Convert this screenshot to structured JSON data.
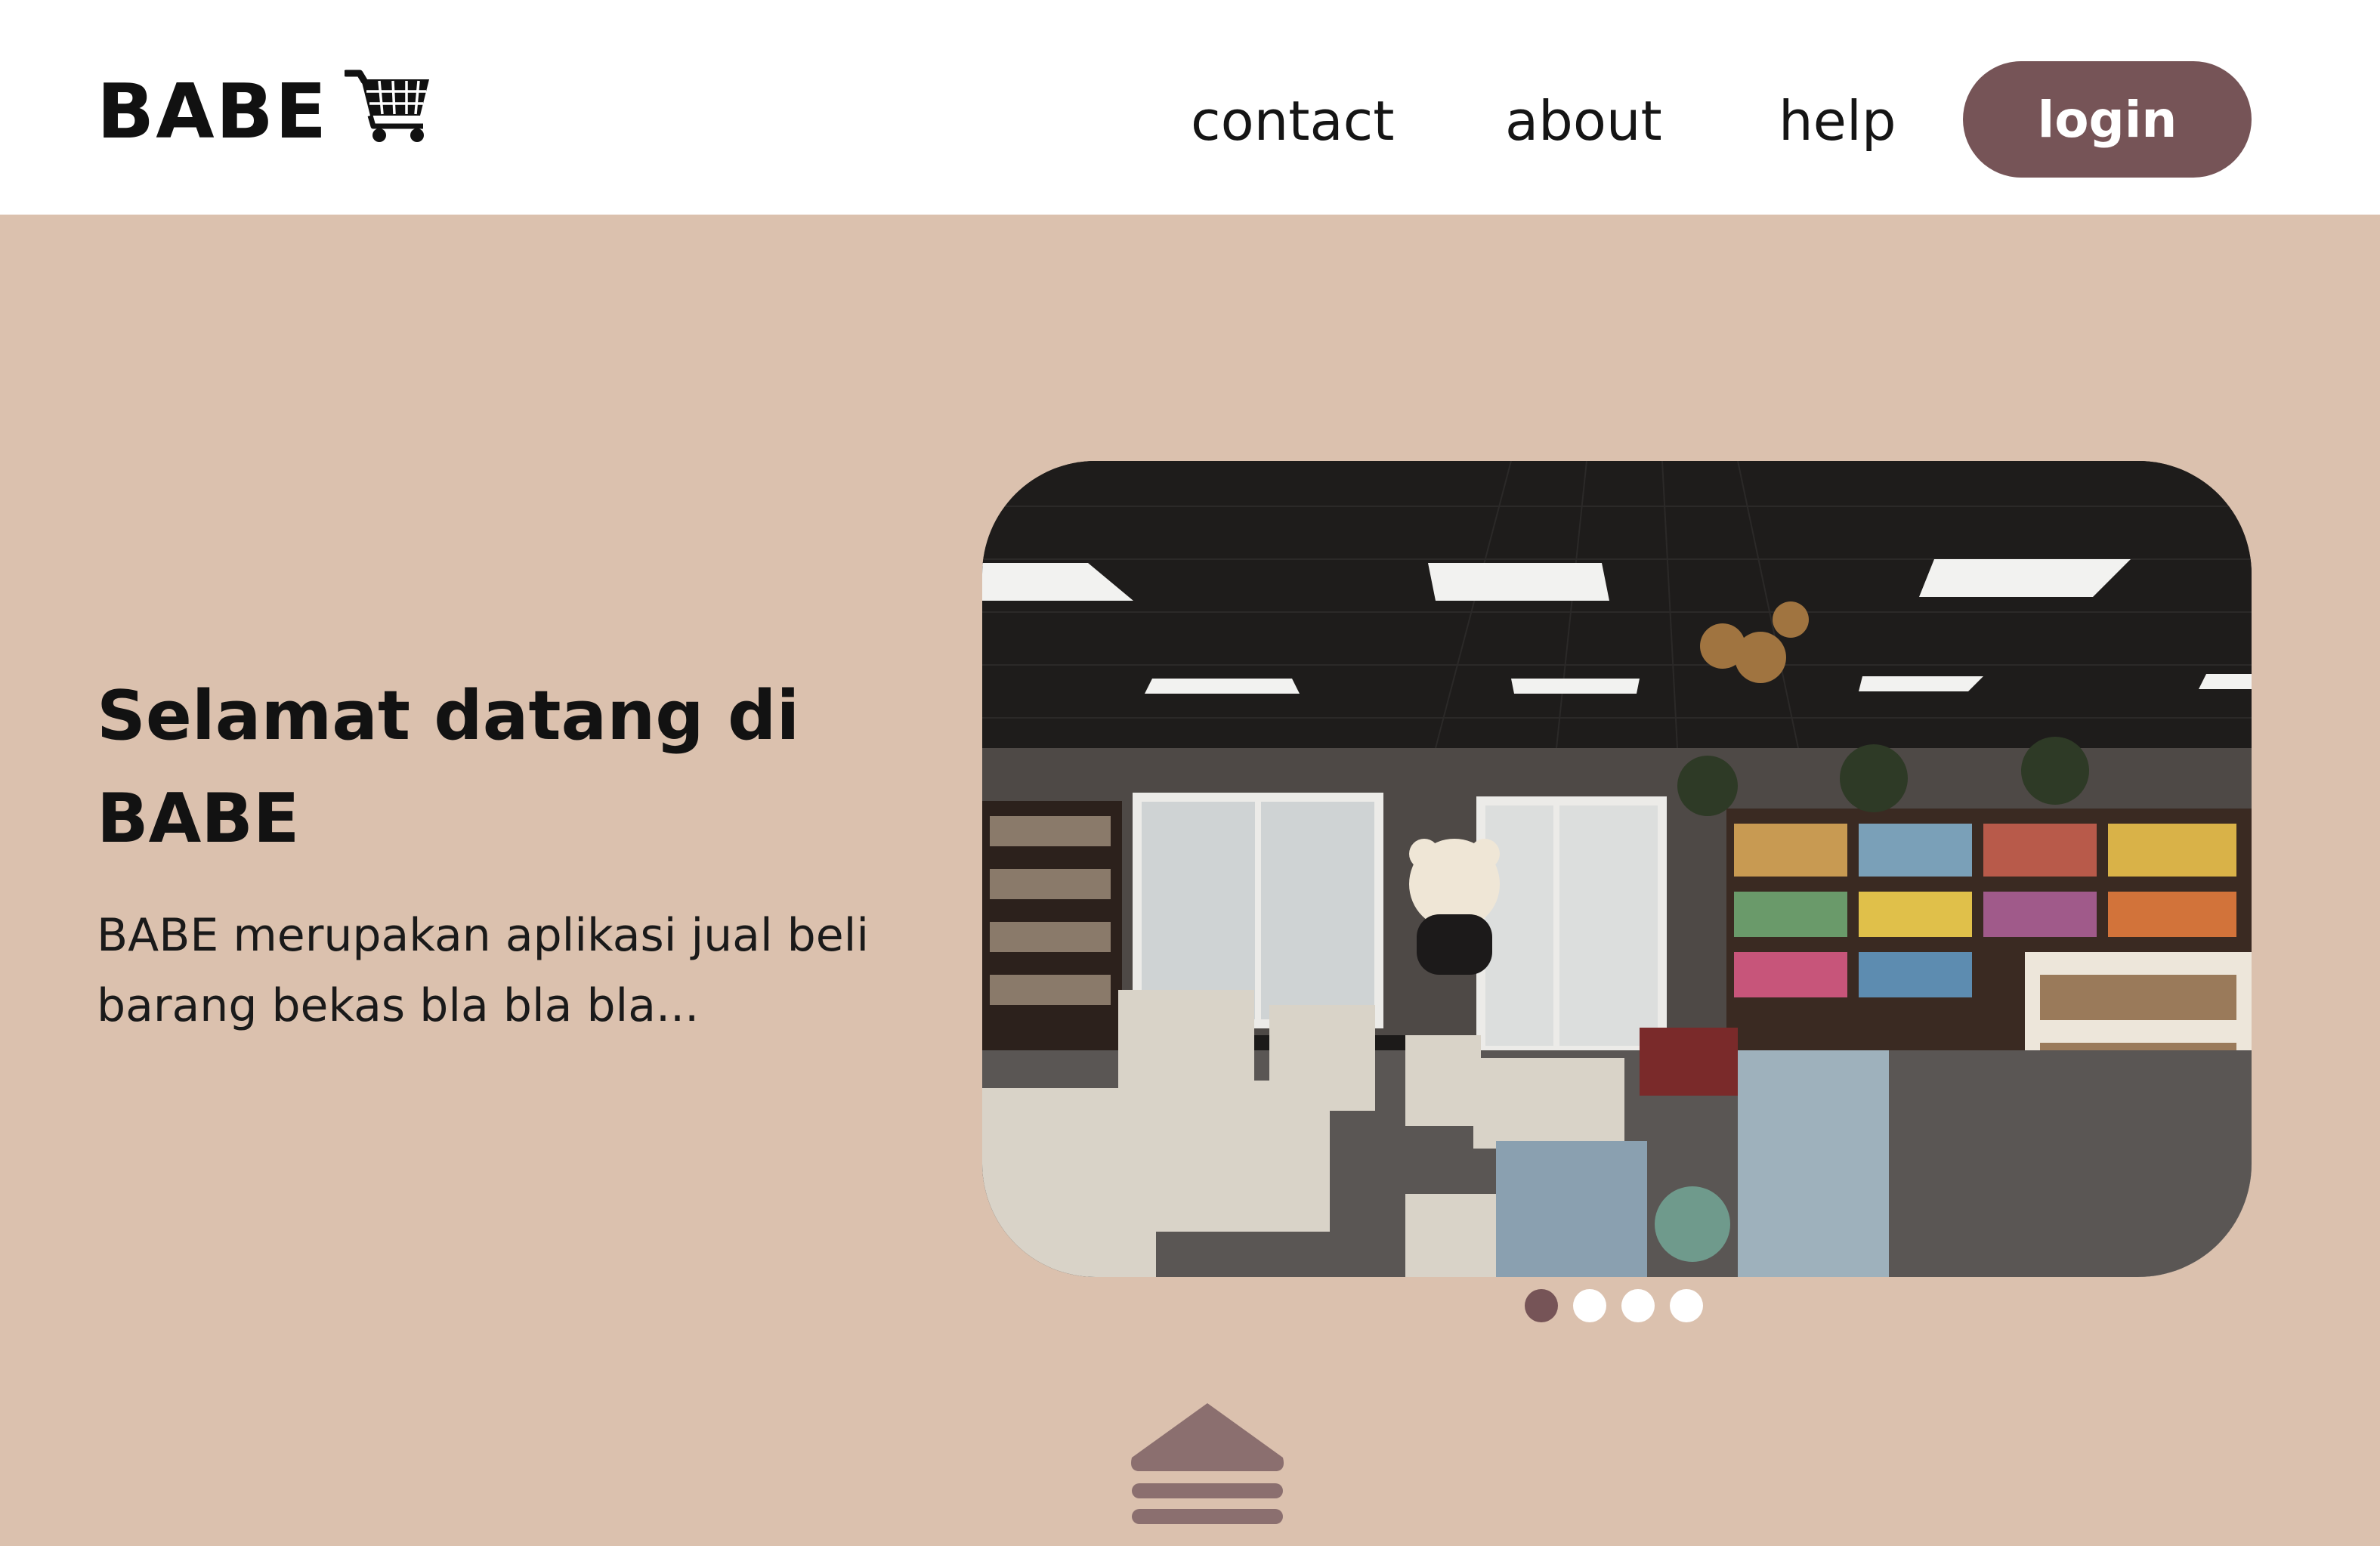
{
  "header": {
    "brand": "BABE",
    "brand_icon": "shopping-cart-icon",
    "nav": {
      "contact": "contact",
      "about": "about",
      "help": "help"
    },
    "login_label": "login"
  },
  "hero": {
    "title": "Selamat datang di BABE",
    "description": "BABE merupakan aplikasi jual beli barang bekas bla bla bla..."
  },
  "carousel": {
    "slide_count": 4,
    "active_slide": 1
  },
  "scroll_icon": "scroll-up-icon",
  "colors": {
    "background": "#dbc1ae",
    "header": "#ffffff",
    "accent": "#765457",
    "text": "#141414",
    "dot_inactive": "#ffffff"
  }
}
